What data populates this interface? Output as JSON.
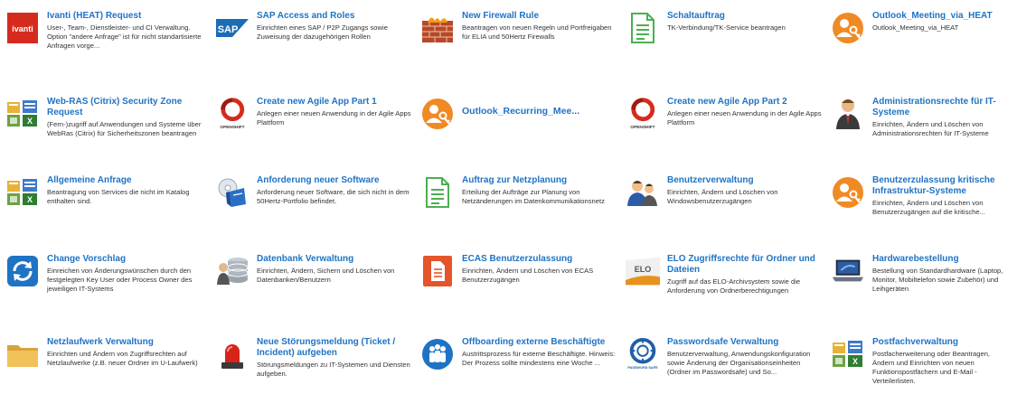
{
  "tiles": [
    {
      "id": "ivanti",
      "icon": "ivanti-logo-icon",
      "icon_text": "ivanti",
      "title": "Ivanti (HEAT) Request",
      "desc": "User-, Team-, Dienstleister- und CI Verwaltung. Option \"andere Anfrage\" ist für nicht standartisierte Anfragen vorge..."
    },
    {
      "id": "sap",
      "icon": "sap-logo-icon",
      "icon_text": "SAP",
      "title": "SAP Access and Roles",
      "desc": "Einrichten eines SAP / P2P Zugangs sowie Zuweisung der dazugehörigen Rollen"
    },
    {
      "id": "firewall",
      "icon": "firewall-icon",
      "title": "New Firewall Rule",
      "desc": "Beantragen von neuen Regeln und Portfreigaben für ELIA und 50Hertz Firewalls"
    },
    {
      "id": "schaltauftrag",
      "icon": "document-icon",
      "title": "Schaltauftrag",
      "desc": "TK-Verbindung/TK-Service beantragen"
    },
    {
      "id": "outlook-meeting",
      "icon": "key-person-icon",
      "title": "Outlook_Meeting_via_HEAT",
      "desc": "Outlook_Meeting_via_HEAT"
    },
    {
      "id": "webras",
      "icon": "office-apps-icon",
      "title": "Web-RAS (Citrix) Security Zone Request",
      "desc": "(Fern-)zugriff auf Anwendungen und Systeme über WebRas (Citrix) für Sicherheitszonen beantragen"
    },
    {
      "id": "agile1",
      "icon": "openshift-icon",
      "icon_text": "OPENSHIFT",
      "title": "Create new Agile App Part 1",
      "desc": "Anlegen einer neuen Anwendung in der Agile Apps Plattform"
    },
    {
      "id": "outlook-recurring",
      "icon": "key-person-icon",
      "title": "Outlook_Recurring_Mee...",
      "desc": ""
    },
    {
      "id": "agile2",
      "icon": "openshift-icon",
      "icon_text": "OPENSHIFT",
      "title": "Create new Agile App Part 2",
      "desc": "Anlegen einer neuen Anwendung in der Agile Apps Plattform"
    },
    {
      "id": "adminrechte",
      "icon": "admin-person-icon",
      "title": "Administrationsrechte für IT-Systeme",
      "desc": "Einrichten, Ändern und Löschen von Administrationsrechten für IT-Systeme"
    },
    {
      "id": "allgemein",
      "icon": "office-apps-icon",
      "title": "Allgemeine Anfrage",
      "desc": "Beantragung von Services die nicht im Katalog enthalten sind."
    },
    {
      "id": "software",
      "icon": "software-box-icon",
      "title": "Anforderung neuer Software",
      "desc": "Anforderung neuer Software, die sich nicht in dem 50Hertz-Portfolio befindet."
    },
    {
      "id": "netzplanung",
      "icon": "document-icon",
      "title": "Auftrag zur Netzplanung",
      "desc": "Erteilung der Aufträge zur Planung von Netzänderungen im Datenkommunikationsnetz"
    },
    {
      "id": "benutzerverwaltung",
      "icon": "users-icon",
      "title": "Benutzerverwaltung",
      "desc": "Einrichten, Ändern und Löschen von Windowsbenutzerzugängen"
    },
    {
      "id": "kritis",
      "icon": "key-person-icon",
      "title": "Benutzerzulassung kritische Infrastruktur-Systeme",
      "desc": "Einrichten, Ändern und Löschen von Benutzerzugängen auf die kritische..."
    },
    {
      "id": "change",
      "icon": "change-arrows-icon",
      "title": "Change Vorschlag",
      "desc": "Einreichen von Änderungswünschen durch den festgelegten Key User oder Process Owner des jeweiligen IT-Systems"
    },
    {
      "id": "datenbank",
      "icon": "database-icon",
      "title": "Datenbank Verwaltung",
      "desc": "Einrichten, Ändern, Sichern und Löschen von Datenbanken/Benutzern"
    },
    {
      "id": "ecas",
      "icon": "ecas-document-icon",
      "title": "ECAS Benutzerzulassung",
      "desc": "Einrichten, Ändern und Löschen von ECAS Benutzerzugängen"
    },
    {
      "id": "elo",
      "icon": "elo-logo-icon",
      "icon_text": "ELO",
      "title": "ELO Zugriffsrechte für Ordner und Dateien",
      "desc": "Zugriff auf das ELO-Archivsystem sowie die Anforderung von Ordnerberechtigungen"
    },
    {
      "id": "hardware",
      "icon": "laptop-icon",
      "title": "Hardwarebestellung",
      "desc": "Bestellung von Standardhardware (Laptop, Monitor, Mobiltelefon sowie Zubehör) und Leihgeräten"
    },
    {
      "id": "netzlaufwerk",
      "icon": "folder-icon",
      "title": "Netzlaufwerk Verwaltung",
      "desc": "Einrichten und Ändern von Zugriffsrechten auf Netzlaufwerke (z.B. neuer Ordner im U-Laufwerk)"
    },
    {
      "id": "stoerung",
      "icon": "alarm-light-icon",
      "title": "Neue Störungsmeldung (Ticket / Incident) aufgeben",
      "desc": "Störungsmeldungen zu IT-Systemen und Diensten aufgeben."
    },
    {
      "id": "offboarding",
      "icon": "group-icon",
      "title": "Offboarding externe Beschäftigte",
      "desc": "Austrittsprozess für externe Beschäftigte. Hinweis: Der Prozess sollte mindestens eine Woche ..."
    },
    {
      "id": "passwordsafe",
      "icon": "password-safe-icon",
      "icon_text": "PASSWORD SAFE",
      "title": "Passwordsafe Verwaltung",
      "desc": "Benutzerverwaltung, Anwendungskonfiguration sowie Änderung der Organisationseinheiten (Ordner im Passwordsafe) und So..."
    },
    {
      "id": "postfach",
      "icon": "office-apps-icon",
      "title": "Postfachverwaltung",
      "desc": "Postfacherweiterung oder Beantragen, Ändern und Einrichten von neuen Funktionspostfächern und E-Mail - Verteilerlisten."
    }
  ]
}
